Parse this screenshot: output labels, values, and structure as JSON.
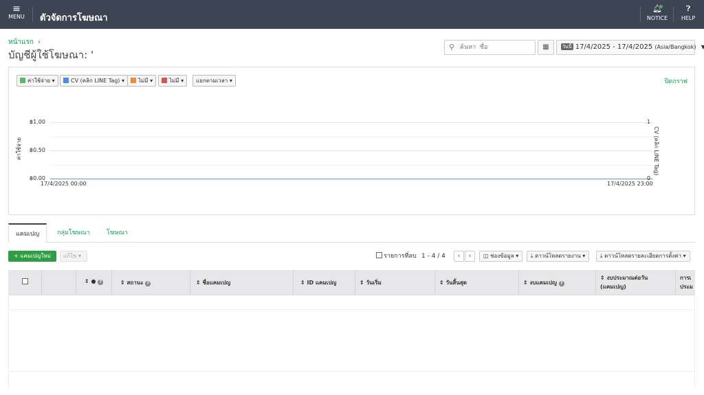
{
  "topbar": {
    "menu_label": "MENU",
    "title": "ตัวจัดการโฆษณา",
    "notice_label": "NOTICE",
    "help_label": "HELP"
  },
  "breadcrumb": {
    "home": "หน้าแรก"
  },
  "page_title": "บัญชีผู้ใช้โฆษณา: '",
  "search": {
    "placeholder": "ค้นหา  ชื่อ"
  },
  "date_range": {
    "day_badge": "วันนี้",
    "range": "17/4/2025 - 17/4/2025",
    "timezone": "(Asia/Bangkok)"
  },
  "chart_controls": {
    "metric1": "ค่าใช้จ่าย",
    "metric2": "CV (คลิก LINE Tag)",
    "metric3": "ไม่มี",
    "metric4": "ไม่มี",
    "split": "แยกตามเวลา",
    "close": "ปิดกราฟ"
  },
  "chart_data": {
    "type": "line",
    "x": [
      "17/4/2025 00:00",
      "17/4/2025 23:00"
    ],
    "x_tick_labels": [
      "17/4/2025 00:00",
      "17/4/2025 23:00"
    ],
    "series": [
      {
        "name": "ค่าใช้จ่าย",
        "values": [
          0,
          0
        ],
        "color": "#5b9bd5"
      },
      {
        "name": "CV (คลิก LINE Tag)",
        "values": [
          0,
          0
        ]
      }
    ],
    "ylabel_left": "ค่าใช้จ่าย",
    "ylabel_right": "CV (คลิก LINE Tag)",
    "y_left_ticks": [
      "฿1.00",
      "฿0.50",
      "฿0.00"
    ],
    "y_right_ticks": [
      "1",
      "0"
    ],
    "ylim_left": [
      0,
      1
    ],
    "ylim_right": [
      0,
      1
    ],
    "grid": true
  },
  "colors": {
    "accent_green": "#06a54a",
    "topbar_bg": "#3d4453",
    "metric1": "#5cb85c",
    "metric2": "#4a90e2",
    "metric3": "#f0883e",
    "metric4": "#d9534f"
  },
  "tabs": [
    "แคมเปญ",
    "กลุ่มโฆษณา",
    "โฆษณา"
  ],
  "toolbar": {
    "new_campaign": "แคมเปญใหม่",
    "edit": "แก้ไข",
    "deleted_items": "รายการที่ลบ",
    "pager": "1 - 4 / 4",
    "columns": "ช่องข้อมูล",
    "download_report": "ดาวน์โหลดรายงาน",
    "download_settings": "ดาวน์โหลดรายละเอียดการตั้งค่า"
  },
  "table": {
    "col_dot": "●",
    "col_status": "สถานะ",
    "col_name": "ชื่อแคมเปญ",
    "col_id": "ID แคมเปญ",
    "col_start": "วันเริ่ม",
    "col_end": "วันสิ้นสุด",
    "col_budget": "งบแคมเปญ",
    "col_daily_1": "งบประมาณต่อวัน",
    "col_daily_2": "(แคมเปญ)",
    "col_next_1": "การเ",
    "col_next_2": "ประม"
  }
}
